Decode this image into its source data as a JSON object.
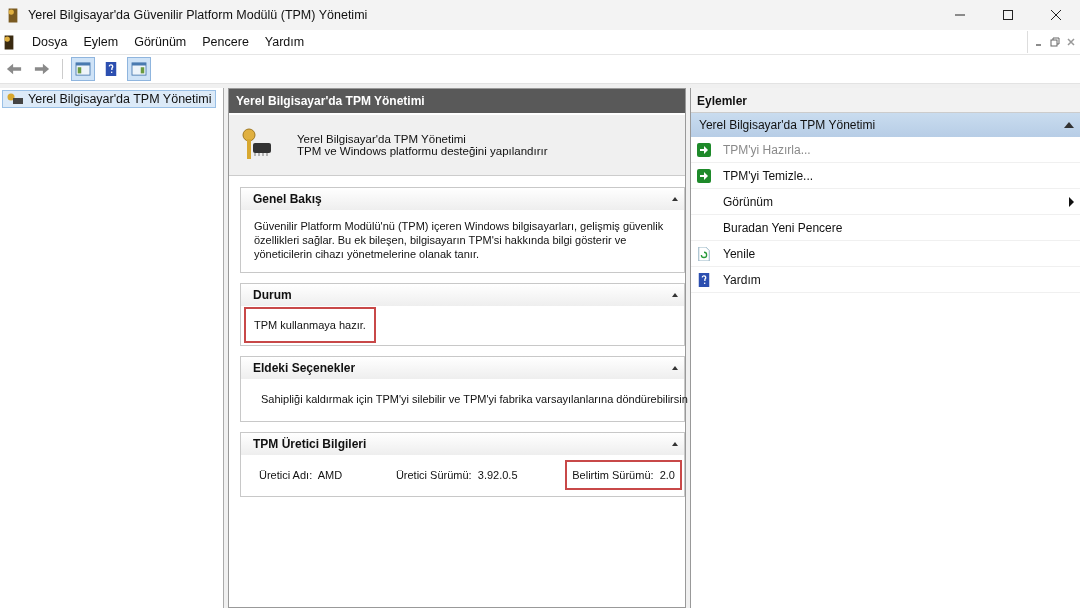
{
  "window": {
    "title": "Yerel Bilgisayar'da Güvenilir Platform Modülü (TPM) Yönetimi"
  },
  "menu": [
    "Dosya",
    "Eylem",
    "Görünüm",
    "Pencere",
    "Yardım"
  ],
  "toolbar": [
    {
      "kind": "back",
      "selected": false
    },
    {
      "kind": "forward",
      "selected": false
    },
    {
      "kind": "tree-toggle",
      "selected": true
    },
    {
      "kind": "help",
      "selected": false
    },
    {
      "kind": "action-toggle",
      "selected": true
    }
  ],
  "tree": [
    {
      "label": "Yerel Bilgisayar'da TPM Yönetimi",
      "selected": true
    }
  ],
  "center": {
    "title": "Yerel Bilgisayar'da TPM Yönetimi",
    "intro_title": "Yerel Bilgisayar'da TPM Yönetimi",
    "intro_subtitle": "TPM ve Windows platformu desteğini yapılandırır",
    "sections": [
      {
        "kind": "text",
        "title": "Genel Bakış",
        "expanded": true,
        "text": "Güvenilir Platform Modülü'nü (TPM) içeren Windows bilgisayarları, gelişmiş güvenlik özellikleri sağlar. Bu ek bileşen, bilgisayarın TPM'si hakkında bilgi gösterir ve yöneticilerin cihazı yönetmelerine olanak tanır.",
        "highlighted": false
      },
      {
        "kind": "text",
        "title": "Durum",
        "expanded": true,
        "text": "TPM kullanmaya hazır.",
        "highlighted": true
      },
      {
        "kind": "options",
        "title": "Eldeki Seçenekler",
        "expanded": true,
        "text": "Sahipliği kaldırmak için TPM'yi silebilir ve TPM'yi fabrika varsayılanlarına döndürebilirsin",
        "highlighted": false
      },
      {
        "kind": "fields",
        "title": "TPM Üretici Bilgileri",
        "expanded": true,
        "fields": [
          {
            "label": "Üretici Adı:",
            "value": "AMD",
            "highlighted": false
          },
          {
            "label": "Üretici Sürümü:",
            "value": "3.92.0.5",
            "highlighted": false
          },
          {
            "label": "Belirtim Sürümü:",
            "value": "2.0",
            "highlighted": true
          }
        ]
      }
    ]
  },
  "actions": {
    "title": "Eylemler",
    "group": {
      "title": "Yerel Bilgisayar'da TPM Yönetimi",
      "expanded": true
    },
    "items": [
      {
        "kind": "run",
        "label": "TPM'yi Hazırla...",
        "disabled": true,
        "submenu": false
      },
      {
        "kind": "run",
        "label": "TPM'yi Temizle...",
        "disabled": false,
        "submenu": false
      },
      {
        "kind": "plain",
        "label": "Görünüm",
        "disabled": false,
        "submenu": true
      },
      {
        "kind": "plain",
        "label": "Buradan Yeni Pencere",
        "disabled": false,
        "submenu": false
      },
      {
        "kind": "refresh",
        "label": "Yenile",
        "disabled": false,
        "submenu": false
      },
      {
        "kind": "help",
        "label": "Yardım",
        "disabled": false,
        "submenu": false
      }
    ]
  }
}
